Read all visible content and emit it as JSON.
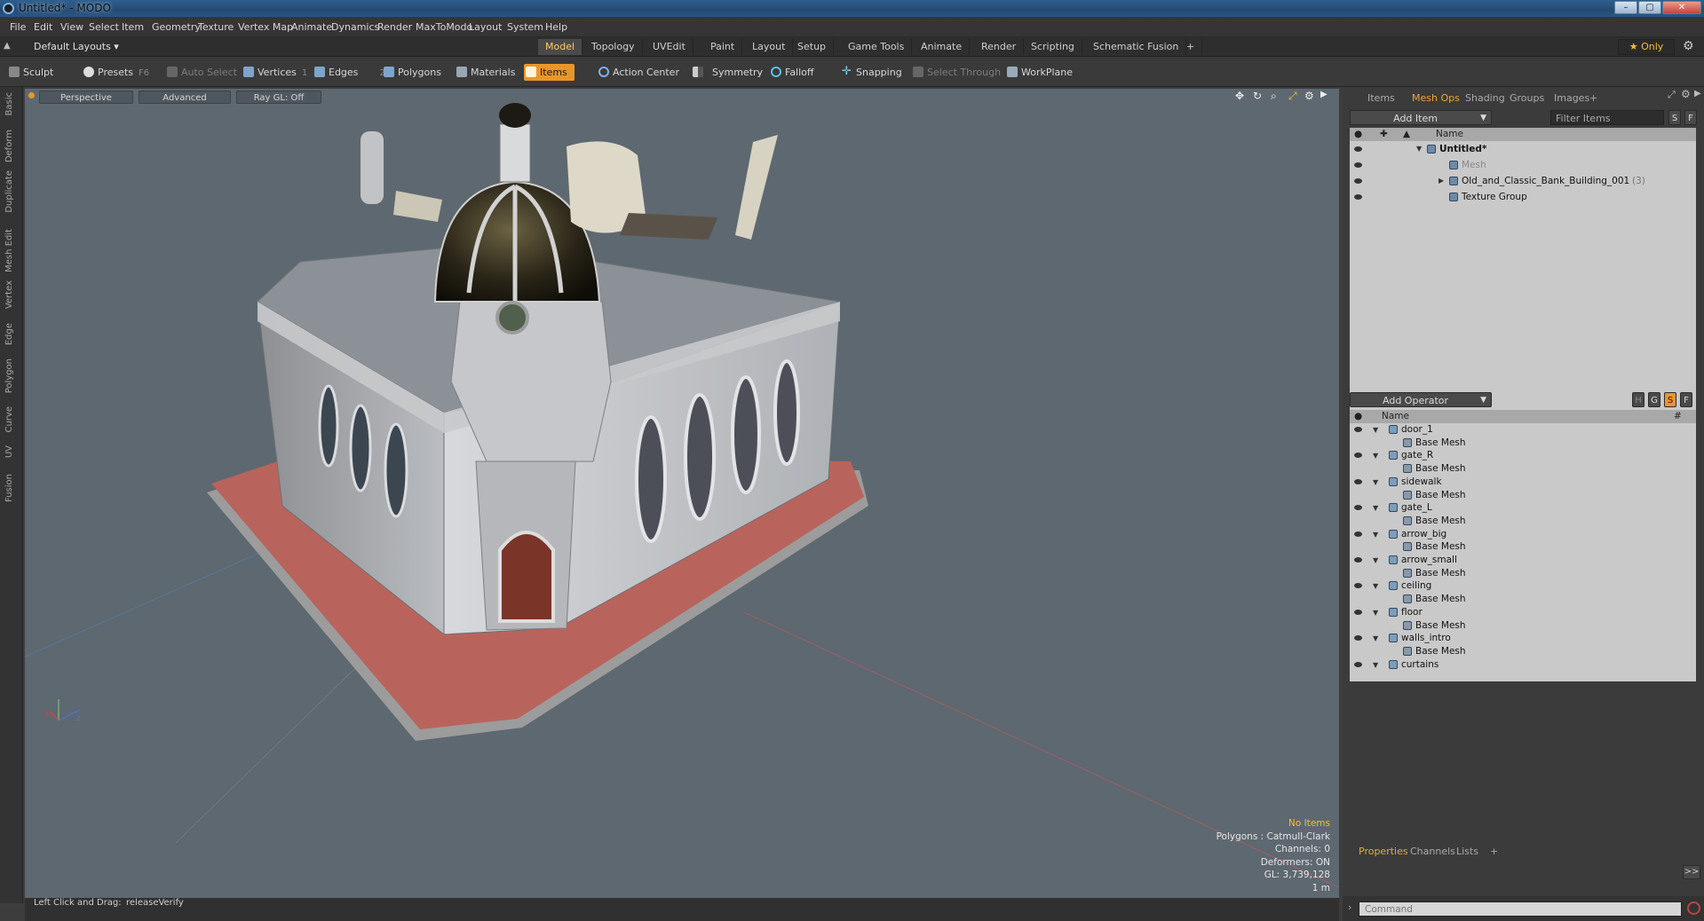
{
  "titlebar": {
    "title": "Untitled* - MODO",
    "min": "–",
    "max": "▢",
    "close": "✕"
  },
  "menu": [
    "File",
    "Edit",
    "View",
    "Select",
    "Item",
    "Geometry",
    "Texture",
    "Vertex Map",
    "Animate",
    "Dynamics",
    "Render",
    "MaxToModo",
    "Layout",
    "System",
    "Help"
  ],
  "layout": {
    "label": "Default Layouts ▾"
  },
  "tabs": [
    {
      "label": "Model",
      "active": true
    },
    {
      "label": "Topology"
    },
    {
      "label": "UVEdit"
    },
    {
      "label": "Paint"
    },
    {
      "label": "Layout"
    },
    {
      "label": "Setup"
    },
    {
      "label": "Game Tools"
    },
    {
      "label": "Animate"
    },
    {
      "label": "Render"
    },
    {
      "label": "Scripting"
    },
    {
      "label": "Schematic Fusion"
    },
    {
      "label": "+"
    }
  ],
  "only": {
    "label": "★  Only"
  },
  "toolbar": {
    "sculpt": "Sculpt",
    "presets": "Presets",
    "presets_key": "F6",
    "auto_select": "Auto Select",
    "vertices": "Vertices",
    "vertices_key": "1",
    "edges": "Edges",
    "edges_key": "2",
    "polygons": "Polygons",
    "materials": "Materials",
    "items": "Items",
    "action_center": "Action Center",
    "symmetry": "Symmetry",
    "falloff": "Falloff",
    "snapping": "Snapping",
    "select_through": "Select Through",
    "workplane": "WorkPlane"
  },
  "left_tabs": [
    "Basic",
    "Deform",
    "Duplicate",
    "Mesh Edit",
    "Vertex",
    "Edge",
    "Polygon",
    "Curve",
    "UV",
    "Fusion"
  ],
  "viewport": {
    "perspective": "Perspective",
    "advanced": "Advanced",
    "raygl": "Ray GL: Off",
    "stats": {
      "no_items": "No Items",
      "polygons": "Polygons : Catmull-Clark",
      "channels": "Channels: 0",
      "deformers": "Deformers: ON",
      "gl": "GL: 3,739,128",
      "scale": "1 m"
    }
  },
  "statusbar": {
    "hint": "Left Click and Drag:",
    "action": "releaseVerify"
  },
  "items_panel": {
    "tabs": [
      "Items",
      "Mesh Ops",
      "Shading",
      "Groups",
      "Images",
      "+"
    ],
    "add_item": "Add Item",
    "filter": "Filter Items",
    "s": "S",
    "f": "F",
    "name_col": "Name",
    "rows": [
      {
        "label": "Untitled*",
        "indent": 0,
        "bold": true
      },
      {
        "label": "Mesh",
        "indent": 1,
        "dim": true
      },
      {
        "label": "Old_and_Classic_Bank_Building_001",
        "count": "(3)",
        "indent": 1
      },
      {
        "label": "Texture Group",
        "indent": 1
      }
    ]
  },
  "ops_panel": {
    "add_operator": "Add Operator",
    "h": "H",
    "g": "G",
    "s": "S",
    "f": "F",
    "name_col": "Name",
    "hash_col": "#",
    "rows": [
      {
        "label": "door_1",
        "group": true
      },
      {
        "label": "Base Mesh"
      },
      {
        "label": "gate_R",
        "group": true
      },
      {
        "label": "Base Mesh"
      },
      {
        "label": "sidewalk",
        "group": true
      },
      {
        "label": "Base Mesh"
      },
      {
        "label": "gate_L",
        "group": true
      },
      {
        "label": "Base Mesh"
      },
      {
        "label": "arrow_big",
        "group": true
      },
      {
        "label": "Base Mesh"
      },
      {
        "label": "arrow_small",
        "group": true
      },
      {
        "label": "Base Mesh"
      },
      {
        "label": "ceiling",
        "group": true
      },
      {
        "label": "Base Mesh"
      },
      {
        "label": "floor",
        "group": true
      },
      {
        "label": "Base Mesh"
      },
      {
        "label": "walls_intro",
        "group": true
      },
      {
        "label": "Base Mesh"
      },
      {
        "label": "curtains",
        "group": true
      }
    ]
  },
  "props_panel": {
    "tabs": [
      "Properties",
      "Channels",
      "Lists",
      "+"
    ],
    "expand": ">>"
  },
  "command": {
    "placeholder": "Command"
  }
}
